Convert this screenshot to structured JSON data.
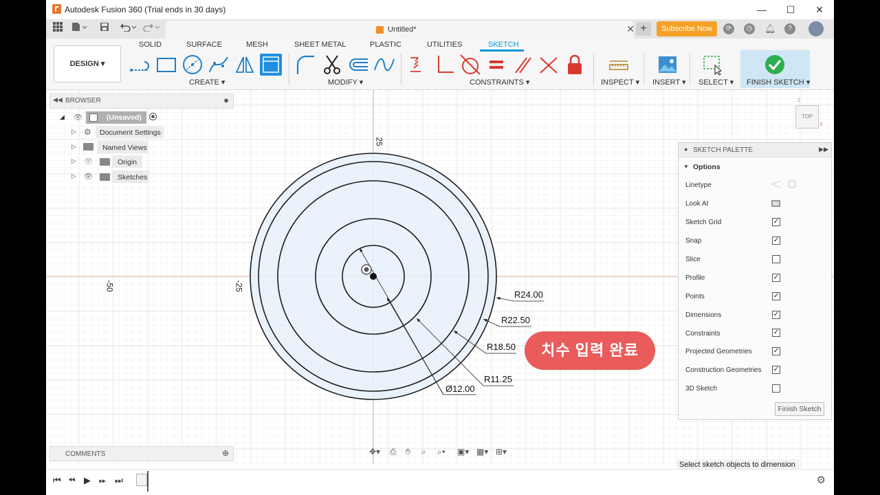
{
  "window": {
    "title": "Autodesk Fusion 360 (Trial ends in 30 days)",
    "minimize": "—",
    "maximize": "☐",
    "close": "✕"
  },
  "tabbar": {
    "document_name": "Untitled*",
    "close_tab": "✕",
    "new_tab": "+",
    "subscribe": "Subscribe Now"
  },
  "ribbon": {
    "workspace": "DESIGN ▾",
    "tabs": [
      "SOLID",
      "SURFACE",
      "MESH",
      "SHEET METAL",
      "PLASTIC",
      "UTILITIES",
      "SKETCH"
    ],
    "active_tab": "SKETCH",
    "groups": {
      "create": "CREATE ▾",
      "modify": "MODIFY ▾",
      "constraints": "CONSTRAINTS ▾",
      "inspect": "INSPECT ▾",
      "insert": "INSERT ▾",
      "select": "SELECT ▾",
      "finish": "FINISH SKETCH ▾"
    }
  },
  "browser": {
    "header": "BROWSER",
    "root": "(Unsaved)",
    "items": [
      "Document Settings",
      "Named Views",
      "Origin",
      "Sketches"
    ]
  },
  "comments": {
    "header": "COMMENTS"
  },
  "view_cube": {
    "label": "TOP",
    "axis_z": "Z",
    "axis_x": "X"
  },
  "canvas": {
    "axis_labels": {
      "top": "25",
      "left_far": "-50",
      "left_near": "-25"
    },
    "dimensions": [
      "R24.00",
      "R22.50",
      "R18.50",
      "R11.25",
      "Ø12.00"
    ]
  },
  "annotation": {
    "text": "치수 입력 완료",
    "color": "#e8504f"
  },
  "palette": {
    "header": "SKETCH PALETTE",
    "section": "Options",
    "options": [
      {
        "label": "Linetype",
        "type": "icons"
      },
      {
        "label": "Look At",
        "type": "icon"
      },
      {
        "label": "Sketch Grid",
        "checked": true
      },
      {
        "label": "Snap",
        "checked": true
      },
      {
        "label": "Slice",
        "checked": false
      },
      {
        "label": "Profile",
        "checked": true
      },
      {
        "label": "Points",
        "checked": true
      },
      {
        "label": "Dimensions",
        "checked": true
      },
      {
        "label": "Constraints",
        "checked": true
      },
      {
        "label": "Projected Geometries",
        "checked": true
      },
      {
        "label": "Construction Geometries",
        "checked": true
      },
      {
        "label": "3D Sketch",
        "checked": false
      }
    ],
    "finish_button": "Finish Sketch"
  },
  "status": {
    "text": "Select sketch objects to dimension"
  },
  "colors": {
    "accent": "#0696d7",
    "subscribe": "#f4a128",
    "finish_check": "#2eae4e",
    "constraint_red": "#d9382f"
  }
}
